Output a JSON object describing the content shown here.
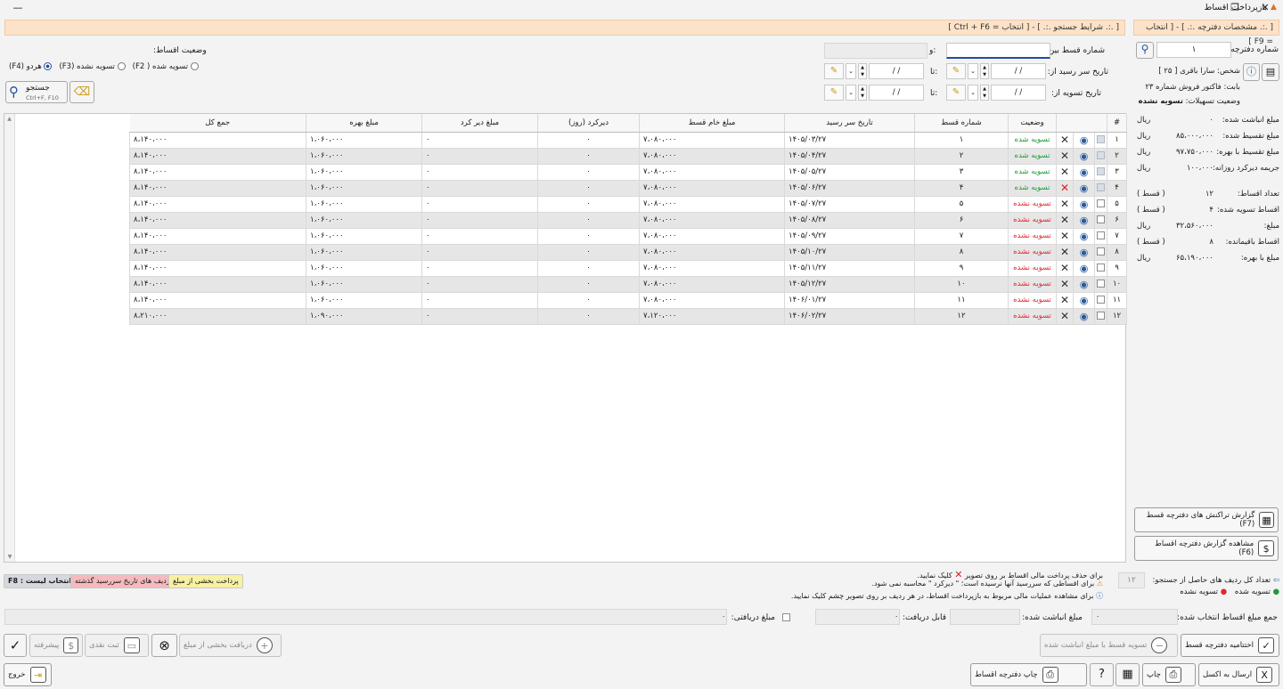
{
  "window": {
    "title": "بازپرداخت اقساط",
    "min_glyph": "—",
    "max_glyph": "❐",
    "close_glyph": "✕"
  },
  "search_header": "[ .:. شرایط جستجو .:. ] - [ انتخاب = Ctrl + F6 ]",
  "book_header": "[ .:. مشخصات دفترچه .:. ] - [ انتخاب = F9 ]",
  "filters": {
    "installment_between_label": "شماره قسط بین:",
    "and_label": "و:",
    "due_from_label": "تاریخ سر رسید از:",
    "settle_from_label": "تاریخ تسویه از:",
    "to_label": "تا:",
    "date_placeholder": "/ /",
    "status_title": "وضعیت اقساط:",
    "opt_settled": "تسویه شده ( F2)",
    "opt_unsettled": "تسویه نشده (F3)",
    "opt_both": "هردو (F4)",
    "search_label": "جستجو",
    "search_shortcut": "Ctrl+F, F10"
  },
  "table": {
    "headers": [
      "#",
      "وضعیت",
      "شماره قسط",
      "تاریخ سر رسید",
      "مبلغ خام قسط",
      "دیرکرد (روز)",
      "مبلغ دیر کرد",
      "مبلغ بهره",
      "جمع کل"
    ],
    "rows": [
      {
        "n": "۱",
        "status": "تسویه شده",
        "done": true,
        "inst": "۱",
        "due": "۱۴۰۵/۰۳/۲۷",
        "raw": "۷،۰۸۰،۰۰۰",
        "delay": "۰",
        "late": "۰",
        "interest": "۱،۰۶۰،۰۰۰",
        "total": "۸،۱۴۰،۰۰۰"
      },
      {
        "n": "۲",
        "status": "تسویه شده",
        "done": true,
        "inst": "۲",
        "due": "۱۴۰۵/۰۴/۲۷",
        "raw": "۷،۰۸۰،۰۰۰",
        "delay": "۰",
        "late": "۰",
        "interest": "۱،۰۶۰،۰۰۰",
        "total": "۸،۱۴۰،۰۰۰"
      },
      {
        "n": "۳",
        "status": "تسویه شده",
        "done": true,
        "inst": "۳",
        "due": "۱۴۰۵/۰۵/۲۷",
        "raw": "۷،۰۸۰،۰۰۰",
        "delay": "۰",
        "late": "۰",
        "interest": "۱،۰۶۰،۰۰۰",
        "total": "۸،۱۴۰،۰۰۰"
      },
      {
        "n": "۴",
        "status": "تسویه شده",
        "done": true,
        "inst": "۴",
        "due": "۱۴۰۵/۰۶/۲۷",
        "raw": "۷،۰۸۰،۰۰۰",
        "delay": "۰",
        "late": "۰",
        "interest": "۱،۰۶۰،۰۰۰",
        "total": "۸،۱۴۰،۰۰۰"
      },
      {
        "n": "۵",
        "status": "تسویه نشده",
        "done": false,
        "inst": "۵",
        "due": "۱۴۰۵/۰۷/۲۷",
        "raw": "۷،۰۸۰،۰۰۰",
        "delay": "۰",
        "late": "۰",
        "interest": "۱،۰۶۰،۰۰۰",
        "total": "۸،۱۴۰،۰۰۰"
      },
      {
        "n": "۶",
        "status": "تسویه نشده",
        "done": false,
        "inst": "۶",
        "due": "۱۴۰۵/۰۸/۲۷",
        "raw": "۷،۰۸۰،۰۰۰",
        "delay": "۰",
        "late": "۰",
        "interest": "۱،۰۶۰،۰۰۰",
        "total": "۸،۱۴۰،۰۰۰"
      },
      {
        "n": "۷",
        "status": "تسویه نشده",
        "done": false,
        "inst": "۷",
        "due": "۱۴۰۵/۰۹/۲۷",
        "raw": "۷،۰۸۰،۰۰۰",
        "delay": "۰",
        "late": "۰",
        "interest": "۱،۰۶۰،۰۰۰",
        "total": "۸،۱۴۰،۰۰۰"
      },
      {
        "n": "۸",
        "status": "تسویه نشده",
        "done": false,
        "inst": "۸",
        "due": "۱۴۰۵/۱۰/۲۷",
        "raw": "۷،۰۸۰،۰۰۰",
        "delay": "۰",
        "late": "۰",
        "interest": "۱،۰۶۰،۰۰۰",
        "total": "۸،۱۴۰،۰۰۰"
      },
      {
        "n": "۹",
        "status": "تسویه نشده",
        "done": false,
        "inst": "۹",
        "due": "۱۴۰۵/۱۱/۲۷",
        "raw": "۷،۰۸۰،۰۰۰",
        "delay": "۰",
        "late": "۰",
        "interest": "۱،۰۶۰،۰۰۰",
        "total": "۸،۱۴۰،۰۰۰"
      },
      {
        "n": "۱۰",
        "status": "تسویه نشده",
        "done": false,
        "inst": "۱۰",
        "due": "۱۴۰۵/۱۲/۲۷",
        "raw": "۷،۰۸۰،۰۰۰",
        "delay": "۰",
        "late": "۰",
        "interest": "۱،۰۶۰،۰۰۰",
        "total": "۸،۱۴۰،۰۰۰"
      },
      {
        "n": "۱۱",
        "status": "تسویه نشده",
        "done": false,
        "inst": "۱۱",
        "due": "۱۴۰۶/۰۱/۲۷",
        "raw": "۷،۰۸۰،۰۰۰",
        "delay": "۰",
        "late": "۰",
        "interest": "۱،۰۶۰،۰۰۰",
        "total": "۸،۱۴۰،۰۰۰"
      },
      {
        "n": "۱۲",
        "status": "تسویه نشده",
        "done": false,
        "inst": "۱۲",
        "due": "۱۴۰۶/۰۲/۲۷",
        "raw": "۷،۱۲۰،۰۰۰",
        "delay": "۰",
        "late": "۰",
        "interest": "۱،۰۹۰،۰۰۰",
        "total": "۸،۲۱۰،۰۰۰"
      }
    ]
  },
  "book": {
    "book_no_label": "شماره دفترچه:",
    "book_no": "۱",
    "person_label": "شخص:",
    "person": "سارا باقری [ ۲۵ ]",
    "for_label": "بابت:",
    "for": "فاکتور فروش شماره ۲۳",
    "status_label": "وضعیت تسهیلات:",
    "status": "تسویه نشده",
    "stats": [
      {
        "label": "مبلغ انباشت شده:",
        "value": "۰",
        "unit": "ریال"
      },
      {
        "label": "مبلغ تقسیط شده:",
        "value": "۸۵،۰۰۰،۰۰۰",
        "unit": "ریال"
      },
      {
        "label": "مبلغ تقسیط با بهره:",
        "value": "۹۷،۷۵۰،۰۰۰",
        "unit": "ریال"
      },
      {
        "label": "جریمه دیرکرد روزانه:",
        "value": "۱۰۰،۰۰۰",
        "unit": "ریال"
      }
    ],
    "stats2": [
      {
        "label": "تعداد اقساط:",
        "value": "۱۲",
        "unit": "( قسط )"
      },
      {
        "label": "اقساط تسویه شده:",
        "value": "۴",
        "unit": "( قسط )"
      },
      {
        "label": "مبلغ:",
        "value": "۳۲،۵۶۰،۰۰۰",
        "unit": "ریال"
      },
      {
        "label": "اقساط باقیمانده:",
        "value": "۸",
        "unit": "( قسط )"
      },
      {
        "label": "مبلغ با بهره:",
        "value": "۶۵،۱۹۰،۰۰۰",
        "unit": "ریال"
      }
    ],
    "report_tx": "گزارش تراکنش های دفترچه قسط (F7)",
    "report_view": "مشاهده گزارش دفترچه اقساط (F6)"
  },
  "legend": {
    "f8": "F8 : انتخاب لیست",
    "overdue": "ردیف های تاریخ سررسید گذشته",
    "partial": "پرداخت بخشی از مبلغ",
    "hint1": "برای حذف پرداخت مالی اقساط بر روی تصویر",
    "hint1_end": "کلیک نمایید.",
    "hint2": "برای اقساطی که سررسید آنها نرسیده است؛ \" دیرکرد \" محاسبه نمی شود.",
    "hint3": "برای مشاهده عملیات مالی مربوط به بازپرداخت اقساط، در هر ردیف بر روی تصویر چشم کلیک نمایید.",
    "rowcount_label": "تعداد کل ردیف های حاصل از جستجو:",
    "rowcount": "۱۲",
    "settled": "تسویه شده",
    "unsettled": "تسویه نشده"
  },
  "summary": {
    "selected_sum_label": "جمع مبلغ اقساط انتخاب شده:",
    "accum_label": "مبلغ انباشت شده:",
    "receivable_label": "قابل دریافت:",
    "received_label": "مبلغ دریافتی:",
    "zero": "۰"
  },
  "actions": {
    "close_book": "اختتامیه دفترچه قسط",
    "settle_accum": "تسویه قسط با مبلغ انباشت شده",
    "partial_receive": "دریافت بخشی از مبلغ",
    "cash": "ثبت نقدی",
    "advanced": "پیشرفته",
    "excel": "ارسال به اکسل",
    "print": "چاپ",
    "print_book": "چاپ دفترچه اقساط",
    "exit": "خروج"
  },
  "colors": {
    "accent": "#1e4fa3",
    "settled": "#1e9a3a",
    "unsettled": "#e0282d",
    "header_strip": "#fce2c8"
  }
}
